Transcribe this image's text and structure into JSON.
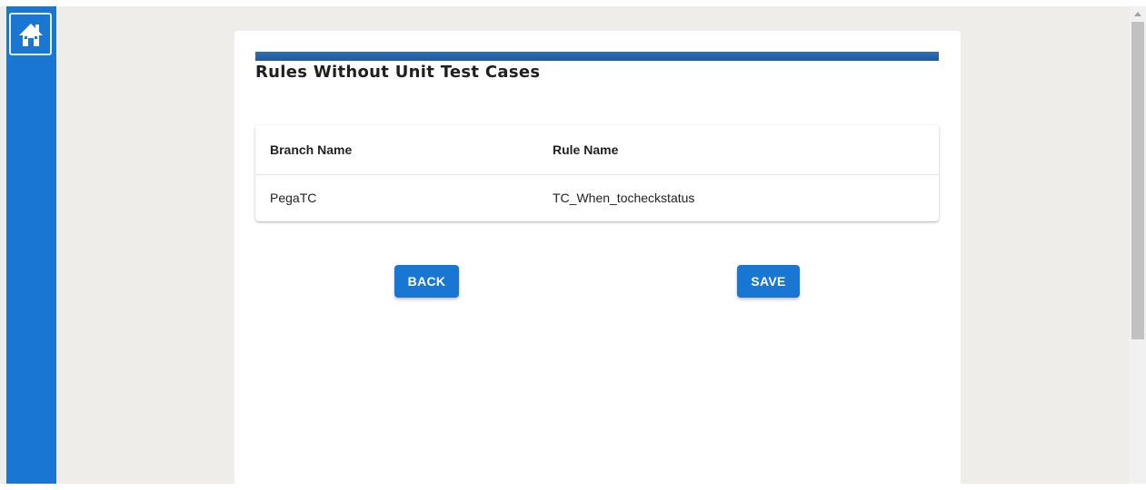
{
  "sidebar": {
    "home_icon": "home-icon",
    "background_color": "#1976d2"
  },
  "page": {
    "title": "Rules Without Unit Test Cases",
    "accent_bar_color": "#2f6eba"
  },
  "table": {
    "headers": [
      "Branch Name",
      "Rule Name"
    ],
    "rows": [
      [
        "PegaTC",
        "TC_When_tocheckstatus"
      ]
    ]
  },
  "actions": {
    "back_label": "BACK",
    "save_label": "SAVE",
    "button_color": "#1976d2"
  }
}
